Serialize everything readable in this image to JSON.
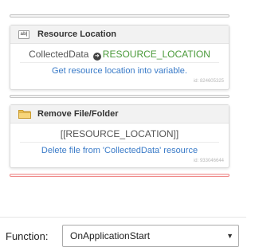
{
  "flow": {
    "actions": [
      {
        "icon": "text-field-icon",
        "icon_text": "ab|",
        "title": "Resource Location",
        "source": "CollectedData",
        "target": "RESOURCE_LOCATION",
        "description": "Get resource location into variable.",
        "id_label": "id: 824605325"
      },
      {
        "icon": "folder-icon",
        "title": "Remove File/Folder",
        "param": "[[RESOURCE_LOCATION]]",
        "description": "Delete file from 'CollectedData' resource",
        "id_label": "id: 933046644"
      }
    ]
  },
  "function_bar": {
    "label": "Function:",
    "selected": "OnApplicationStart"
  },
  "colors": {
    "accent_link": "#3a7bc8",
    "variable_green": "#4a9a3a",
    "error_connector": "#ef8a8a"
  }
}
